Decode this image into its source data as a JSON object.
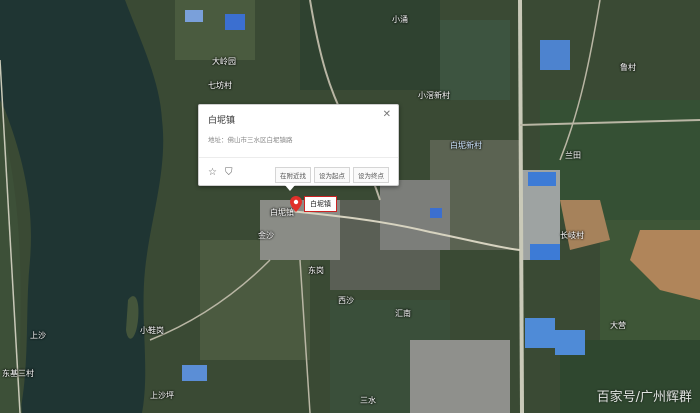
{
  "popup": {
    "title": "白坭镇",
    "address": "地址：佛山市三水区白坭镇路",
    "close_icon": "close-icon",
    "icons": [
      "star-icon",
      "sign-icon"
    ],
    "buttons": [
      "在附近找",
      "设为起点",
      "设为终点"
    ]
  },
  "marker": {
    "label": "白坭镇",
    "color": "#e0302a"
  },
  "map_labels": [
    "大岭园",
    "七坊村",
    "白坭镇",
    "金沙",
    "东岗",
    "汇南",
    "小涌",
    "小滘新村",
    "三水",
    "兰田",
    "鲁村",
    "大营",
    "上沙",
    "东基三村",
    "白坭新村",
    "长岐村",
    "小鞋岗",
    "西沙",
    "上沙坪"
  ],
  "watermark": "百家号/广州辉群"
}
